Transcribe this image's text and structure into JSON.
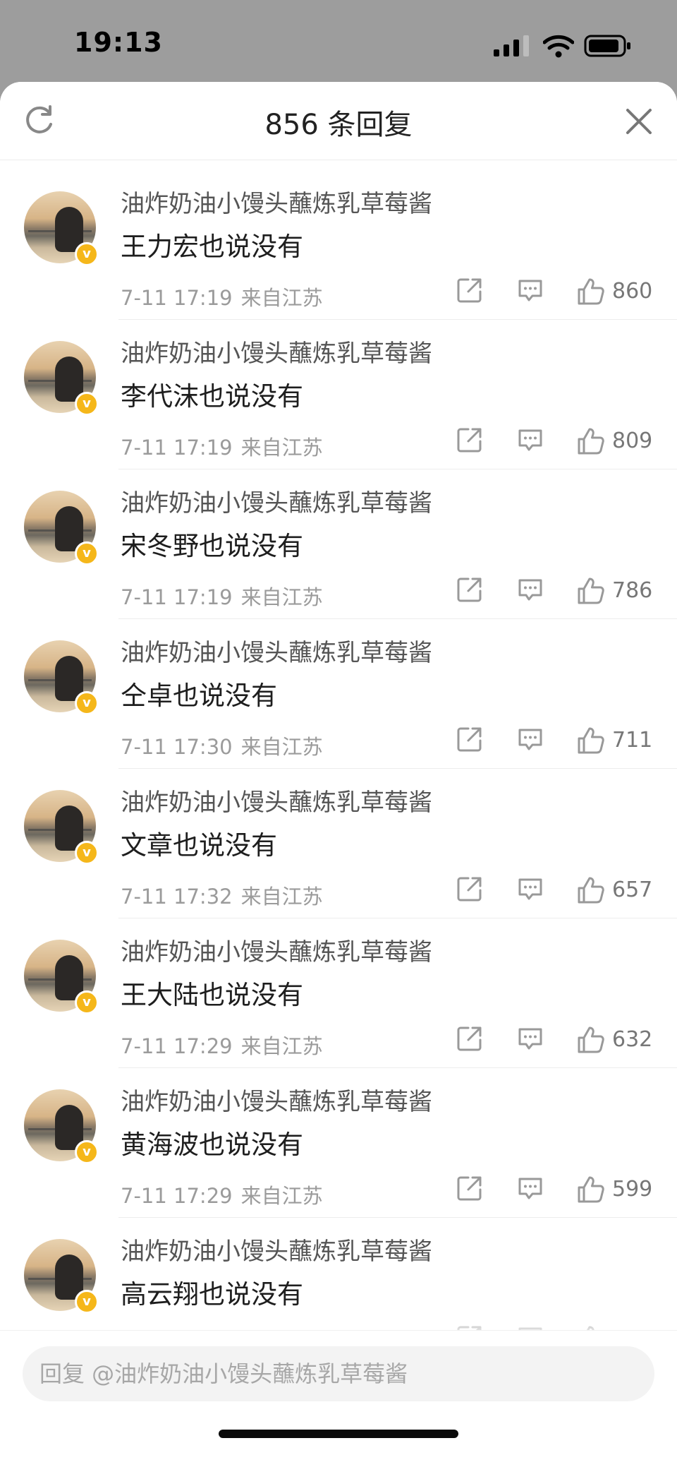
{
  "status_bar": {
    "time": "19:13"
  },
  "header": {
    "title": "856 条回复"
  },
  "replies": [
    {
      "username": "油炸奶油小馒头蘸炼乳草莓酱",
      "text": "王力宏也说没有",
      "date": "7-11 17:19",
      "location": "来自江苏",
      "likes": "860"
    },
    {
      "username": "油炸奶油小馒头蘸炼乳草莓酱",
      "text": "李代沫也说没有",
      "date": "7-11 17:19",
      "location": "来自江苏",
      "likes": "809"
    },
    {
      "username": "油炸奶油小馒头蘸炼乳草莓酱",
      "text": "宋冬野也说没有",
      "date": "7-11 17:19",
      "location": "来自江苏",
      "likes": "786"
    },
    {
      "username": "油炸奶油小馒头蘸炼乳草莓酱",
      "text": "仝卓也说没有",
      "date": "7-11 17:30",
      "location": "来自江苏",
      "likes": "711"
    },
    {
      "username": "油炸奶油小馒头蘸炼乳草莓酱",
      "text": "文章也说没有",
      "date": "7-11 17:32",
      "location": "来自江苏",
      "likes": "657"
    },
    {
      "username": "油炸奶油小馒头蘸炼乳草莓酱",
      "text": "王大陆也说没有",
      "date": "7-11 17:29",
      "location": "来自江苏",
      "likes": "632"
    },
    {
      "username": "油炸奶油小馒头蘸炼乳草莓酱",
      "text": "黄海波也说没有",
      "date": "7-11 17:29",
      "location": "来自江苏",
      "likes": "599"
    },
    {
      "username": "油炸奶油小馒头蘸炼乳草莓酱",
      "text": "高云翔也说没有",
      "date": "",
      "location": "",
      "likes": ""
    }
  ],
  "reply_input": {
    "placeholder": "回复 @油炸奶油小馒头蘸炼乳草莓酱"
  },
  "colors": {
    "verified_badge": "#f5b71a",
    "sheet_bg": "#ffffff",
    "backdrop": "#9d9d9d"
  },
  "icons": [
    "refresh-icon",
    "close-icon",
    "share-icon",
    "comment-icon",
    "like-icon",
    "verified-badge-icon"
  ]
}
